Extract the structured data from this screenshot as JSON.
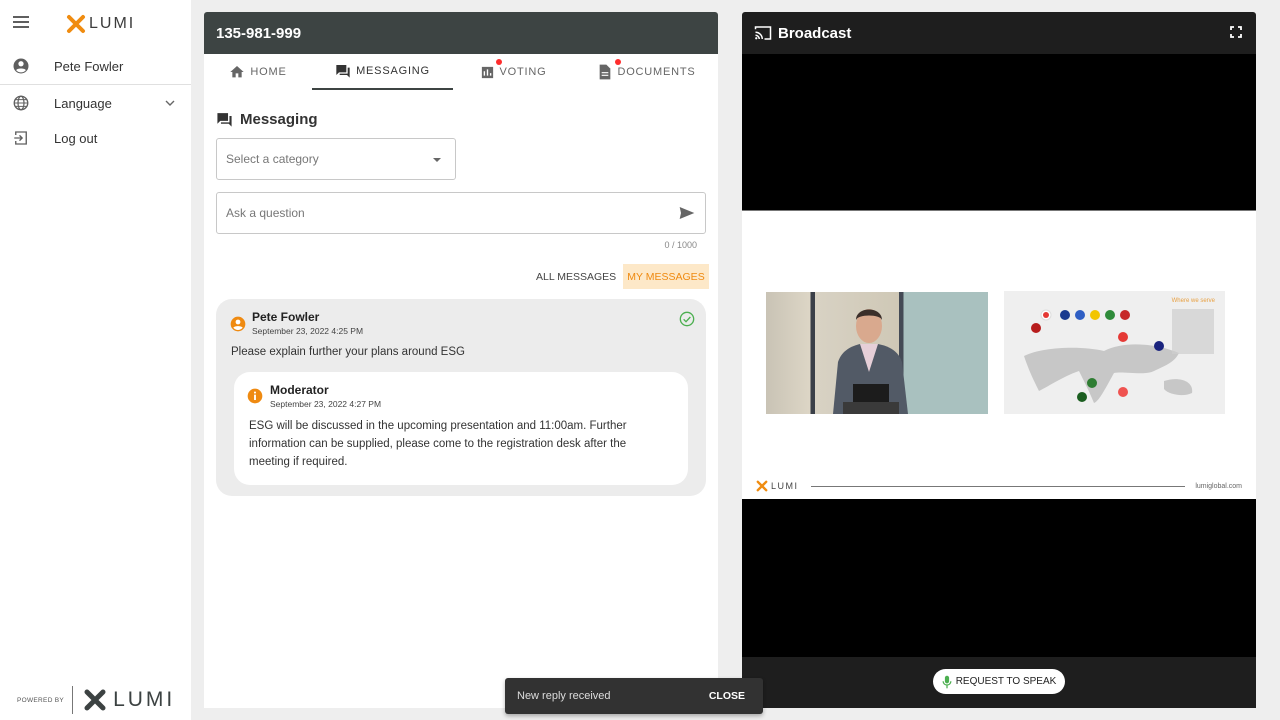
{
  "sidebar": {
    "brand": "LUMI",
    "items": [
      {
        "label": "Pete Fowler",
        "icon": "account-circle-icon"
      },
      {
        "label": "Language",
        "icon": "globe-icon"
      },
      {
        "label": "Log out",
        "icon": "logout-icon"
      }
    ],
    "powered_by": "POWERED BY",
    "footer_brand": "LUMI"
  },
  "panel": {
    "meeting_id": "135-981-999",
    "tabs": [
      {
        "label": "HOME",
        "icon": "home-icon",
        "active": false,
        "badge": false
      },
      {
        "label": "MESSAGING",
        "icon": "forum-icon",
        "active": true,
        "badge": false
      },
      {
        "label": "VOTING",
        "icon": "poll-icon",
        "active": false,
        "badge": true
      },
      {
        "label": "DOCUMENTS",
        "icon": "document-icon",
        "active": false,
        "badge": true
      }
    ],
    "section_title": "Messaging",
    "category_placeholder": "Select a category",
    "question_placeholder": "Ask a question",
    "char_counter": "0 / 1000",
    "filters": {
      "all": "ALL MESSAGES",
      "mine": "MY MESSAGES",
      "selected": "mine"
    },
    "messages": [
      {
        "author": "Pete Fowler",
        "time": "September 23, 2022 4:25 PM",
        "text": "Please explain further your plans around ESG",
        "status": "answered",
        "reply": {
          "author": "Moderator",
          "time": "September 23, 2022 4:27 PM",
          "text": "ESG will be discussed in the upcoming presentation and 11:00am. Further information can be supplied, please come to the registration desk after the meeting if required."
        }
      }
    ]
  },
  "broadcast": {
    "title": "Broadcast",
    "slide": {
      "map_title": "Where we serve",
      "brand": "LUMI",
      "url": "lumiglobal.com"
    },
    "request_to_speak": "REQUEST TO SPEAK"
  },
  "toast": {
    "message": "New reply received",
    "action": "CLOSE"
  },
  "colors": {
    "accent": "#ef8a11",
    "header_dark": "#3d4443",
    "badge": "#ff2d2d",
    "success": "#4caf50",
    "mic": "#4caf50"
  }
}
